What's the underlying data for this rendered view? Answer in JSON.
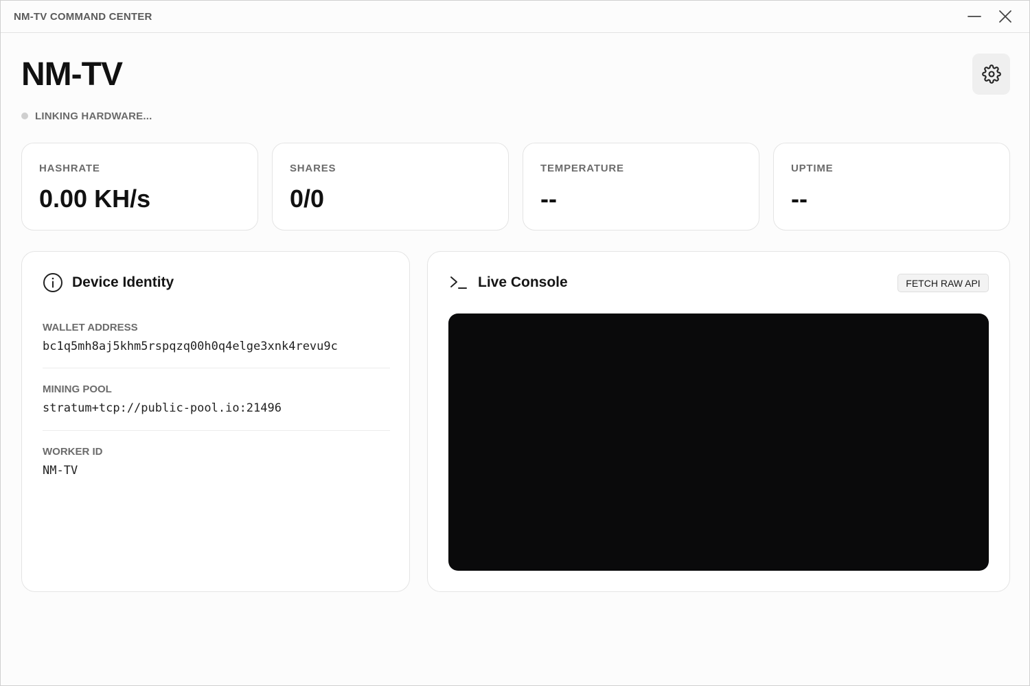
{
  "window": {
    "title": "NM-TV COMMAND CENTER",
    "minimize_icon": "minimize-icon",
    "close_icon": "close-icon"
  },
  "header": {
    "device_name": "NM-TV",
    "status_text": "LINKING HARDWARE...",
    "status_color": "#cfcfcf",
    "settings_icon": "gear-icon"
  },
  "stats": [
    {
      "label": "HASHRATE",
      "value": "0.00 KH/s"
    },
    {
      "label": "SHARES",
      "value": "0/0"
    },
    {
      "label": "TEMPERATURE",
      "value": "--"
    },
    {
      "label": "UPTIME",
      "value": "--"
    }
  ],
  "identity": {
    "title": "Device Identity",
    "icon": "info-icon",
    "fields": [
      {
        "label": "WALLET ADDRESS",
        "value": "bc1q5mh8aj5khm5rspqzq00h0q4elge3xnk4revu9c"
      },
      {
        "label": "MINING POOL",
        "value": "stratum+tcp://public-pool.io:21496"
      },
      {
        "label": "WORKER ID",
        "value": "NM-TV"
      }
    ]
  },
  "console": {
    "title": "Live Console",
    "icon": "terminal-icon",
    "fetch_label": "FETCH RAW API",
    "output": "",
    "background": "#0a0a0b"
  }
}
